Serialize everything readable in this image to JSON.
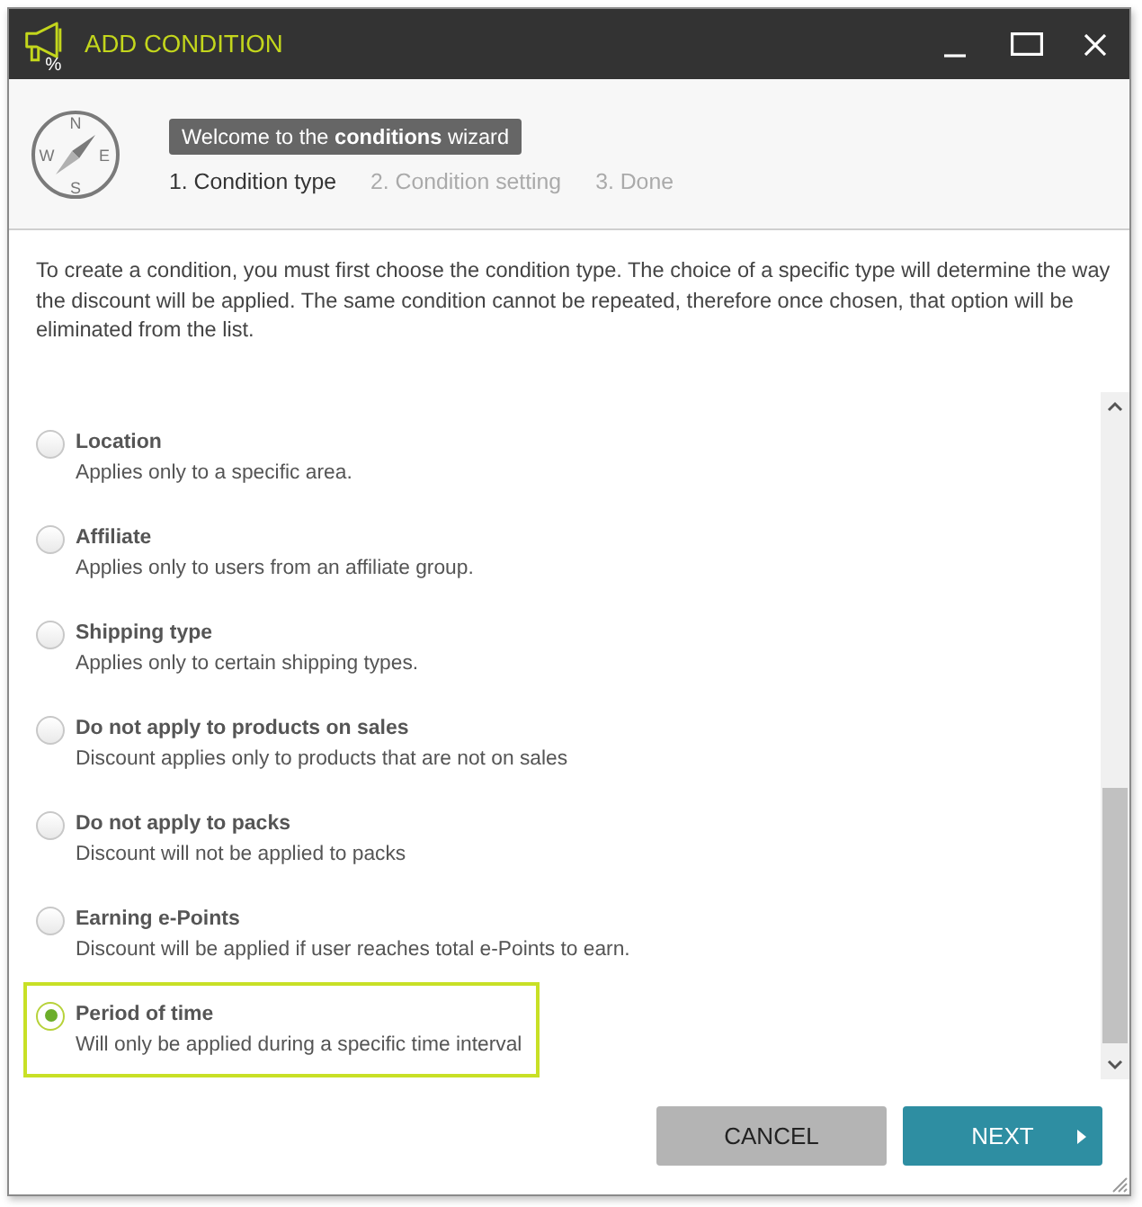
{
  "window": {
    "title": "ADD CONDITION",
    "icon_label": "%"
  },
  "header": {
    "compass_labels": [
      "N",
      "E",
      "S",
      "W"
    ],
    "welcome": "Welcome to the **conditions** wizard",
    "steps": [
      {
        "label": "1. Condition type",
        "selected": true
      },
      {
        "label": "2. Condition setting",
        "selected": false
      },
      {
        "label": "3. Done",
        "selected": false
      }
    ]
  },
  "intro": "To create a condition, you must first choose the condition type. The choice of a specific type will determine the way the discount will be applied. The same condition cannot be repeated, therefore once chosen, that option will be eliminated from the list.",
  "conditions": [
    {
      "title": "Location",
      "description": "Applies only to a specific area.",
      "selected": false
    },
    {
      "title": "Affiliate",
      "description": "Applies only to users from an affiliate group.",
      "selected": false
    },
    {
      "title": "Shipping type",
      "description": "Applies only to certain shipping types.",
      "selected": false
    },
    {
      "title": "Do not apply to products on sales",
      "description": "Discount applies only to products that are not on sales",
      "selected": false
    },
    {
      "title": "Do not apply to packs",
      "description": "Discount will not be applied to packs",
      "selected": false
    },
    {
      "title": "Earning e-Points",
      "description": "Discount will be applied if user reaches total e-Points to earn.",
      "selected": false
    },
    {
      "title": "Period of time",
      "description": "Will only be applied during a specific time interval",
      "selected": true
    }
  ],
  "buttons": [
    {
      "label": "CANCEL",
      "kind": "secondary"
    },
    {
      "label": "NEXT",
      "kind": "primary"
    }
  ]
}
